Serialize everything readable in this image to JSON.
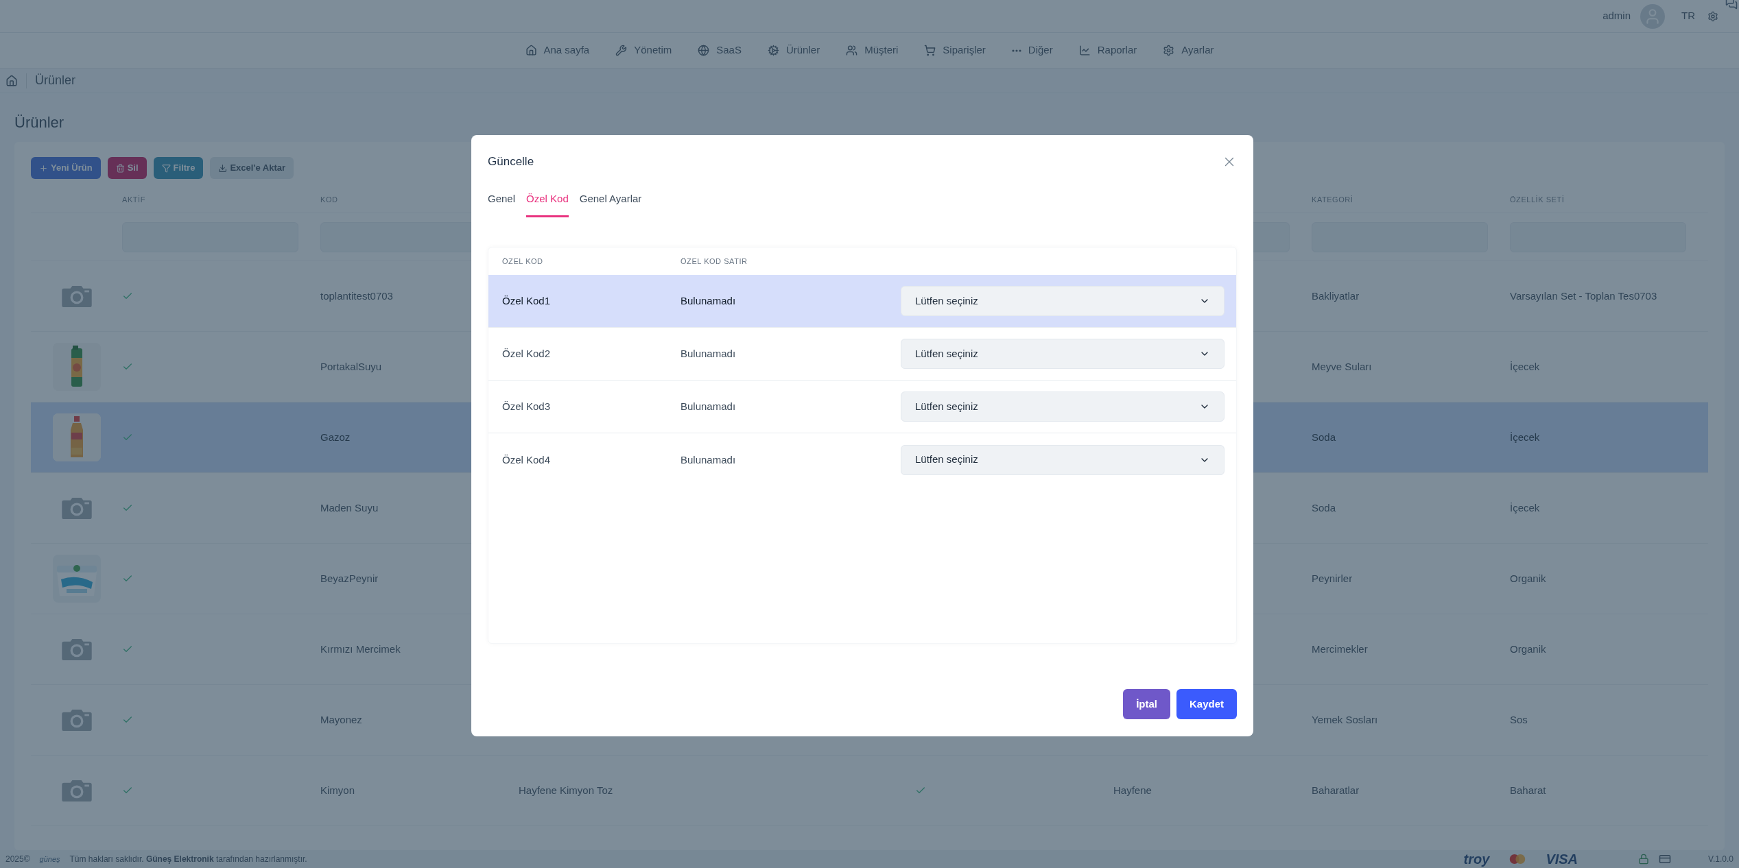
{
  "header": {
    "user": "admin",
    "language": "TR"
  },
  "nav": [
    {
      "label": "Ana sayfa"
    },
    {
      "label": "Yönetim"
    },
    {
      "label": "SaaS"
    },
    {
      "label": "Ürünler"
    },
    {
      "label": "Müşteri"
    },
    {
      "label": "Siparişler"
    },
    {
      "label": "Diğer"
    },
    {
      "label": "Raporlar"
    },
    {
      "label": "Ayarlar"
    }
  ],
  "breadcrumb": "Ürünler",
  "page_title": "Ürünler",
  "toolbar": [
    "Yeni Ürün",
    "Sil",
    "Filtre",
    "Excel'e Aktar"
  ],
  "table": {
    "columns": [
      "AKTİF",
      "KOD",
      null,
      null,
      null,
      null,
      "KATEGORİ",
      "ÖZELLİK SETİ"
    ],
    "rows": [
      {
        "kind": "placeholder",
        "selected": false,
        "active": true,
        "code": "toplantitest0703",
        "category": "Bakliyatlar",
        "feature_set": "Varsayılan Set - Toplan Tes0703"
      },
      {
        "selected": false,
        "active": true,
        "code": "PortakalSuyu",
        "category": "Meyve Suları",
        "feature_set": "İçecek"
      },
      {
        "selected": true,
        "active": true,
        "code": "Gazoz",
        "category": "Soda",
        "feature_set": "İçecek"
      },
      {
        "kind": "placeholder",
        "selected": false,
        "active": true,
        "code": "Maden Suyu",
        "category": "Soda",
        "feature_set": "İçecek"
      },
      {
        "selected": false,
        "active": true,
        "code": "BeyazPeynir",
        "category": "Peynirler",
        "feature_set": "Organik"
      },
      {
        "kind": "placeholder",
        "selected": false,
        "active": true,
        "code": "Kırmızı Mercimek",
        "category": "Mercimekler",
        "feature_set": "Organik"
      },
      {
        "kind": "placeholder",
        "selected": false,
        "active": true,
        "code": "Mayonez",
        "category": "Yemek Sosları",
        "feature_set": "Sos"
      },
      {
        "kind": "placeholder",
        "selected": false,
        "active": true,
        "code": "Kimyon",
        "column_4": "Hayfene Kimyon Toz",
        "column_6_checked": true,
        "column_7": "Hayfene",
        "category": "Baharatlar",
        "feature_set": "Baharat"
      }
    ]
  },
  "modal": {
    "title": "Güncelle",
    "tabs": [
      {
        "label": "Genel",
        "selected": false
      },
      {
        "label": "Özel Kod",
        "selected": true
      },
      {
        "label": "Genel Ayarlar",
        "selected": false
      }
    ],
    "columns": [
      "ÖZEL KOD",
      "ÖZEL KOD SATIR"
    ],
    "rows": [
      {
        "code": "Özel Kod1",
        "line": "Bulunamadı",
        "select": "Lütfen seçiniz",
        "selected": true
      },
      {
        "code": "Özel Kod2",
        "line": "Bulunamadı",
        "select": "Lütfen seçiniz",
        "selected": false
      },
      {
        "code": "Özel Kod3",
        "line": "Bulunamadı",
        "select": "Lütfen seçiniz",
        "selected": false
      },
      {
        "code": "Özel Kod4",
        "line": "Bulunamadı",
        "select": "Lütfen seçiniz",
        "selected": false
      }
    ],
    "buttons": [
      "İptal",
      "Kaydet"
    ]
  },
  "footer": {
    "year": "2025©",
    "logo": "güneş",
    "text": "Tüm hakları saklıdır. **Güneş Elektronik** tarafından hazırlanmıştır.",
    "payment_logos": [
      "troy",
      "VISA"
    ],
    "version": "V.1.0.0"
  }
}
